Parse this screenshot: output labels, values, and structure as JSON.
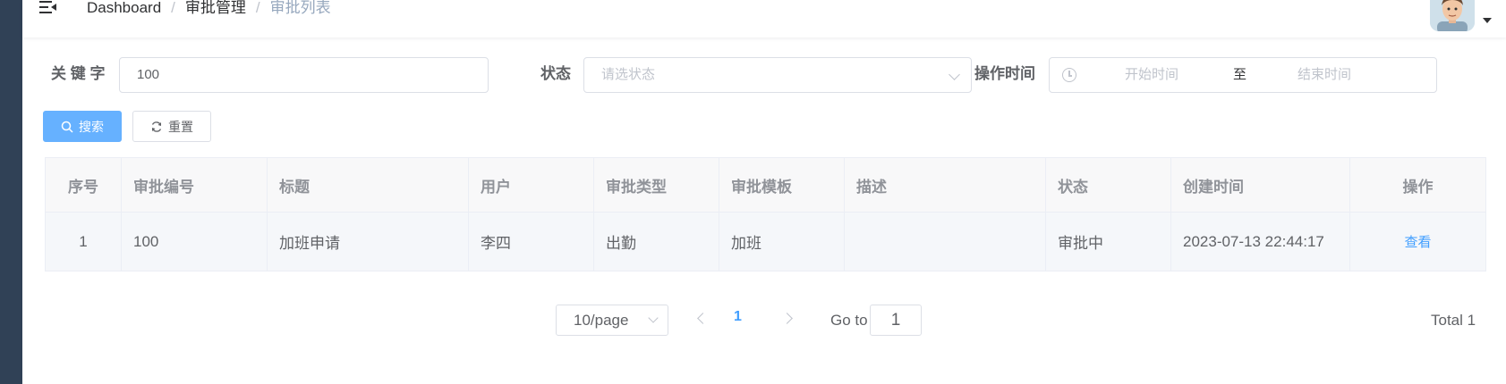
{
  "navbar": {
    "breadcrumb": [
      "Dashboard",
      "审批管理",
      "审批列表"
    ],
    "separator": "/"
  },
  "search_form": {
    "keyword_label": "关 键 字",
    "keyword_value": "100",
    "status_label": "状态",
    "status_placeholder": "请选状态",
    "time_label": "操作时间",
    "start_placeholder": "开始时间",
    "range_separator": "至",
    "end_placeholder": "结束时间",
    "search_button": "搜索",
    "reset_button": "重置"
  },
  "table": {
    "columns": [
      "序号",
      "审批编号",
      "标题",
      "用户",
      "审批类型",
      "审批模板",
      "描述",
      "状态",
      "创建时间",
      "操作"
    ],
    "rows": [
      {
        "index": "1",
        "approval_no": "100",
        "title": "加班申请",
        "user": "李四",
        "type": "出勤",
        "template": "加班",
        "description": "",
        "status": "审批中",
        "created_at": "2023-07-13 22:44:17",
        "action": "查看"
      }
    ]
  },
  "pagination": {
    "page_size": "10/page",
    "current_page": "1",
    "goto_label": "Go to",
    "goto_value": "1",
    "total": "Total 1"
  },
  "colors": {
    "sidebar": "#304156",
    "primary": "#409eff",
    "primary_light": "#66b1ff"
  }
}
